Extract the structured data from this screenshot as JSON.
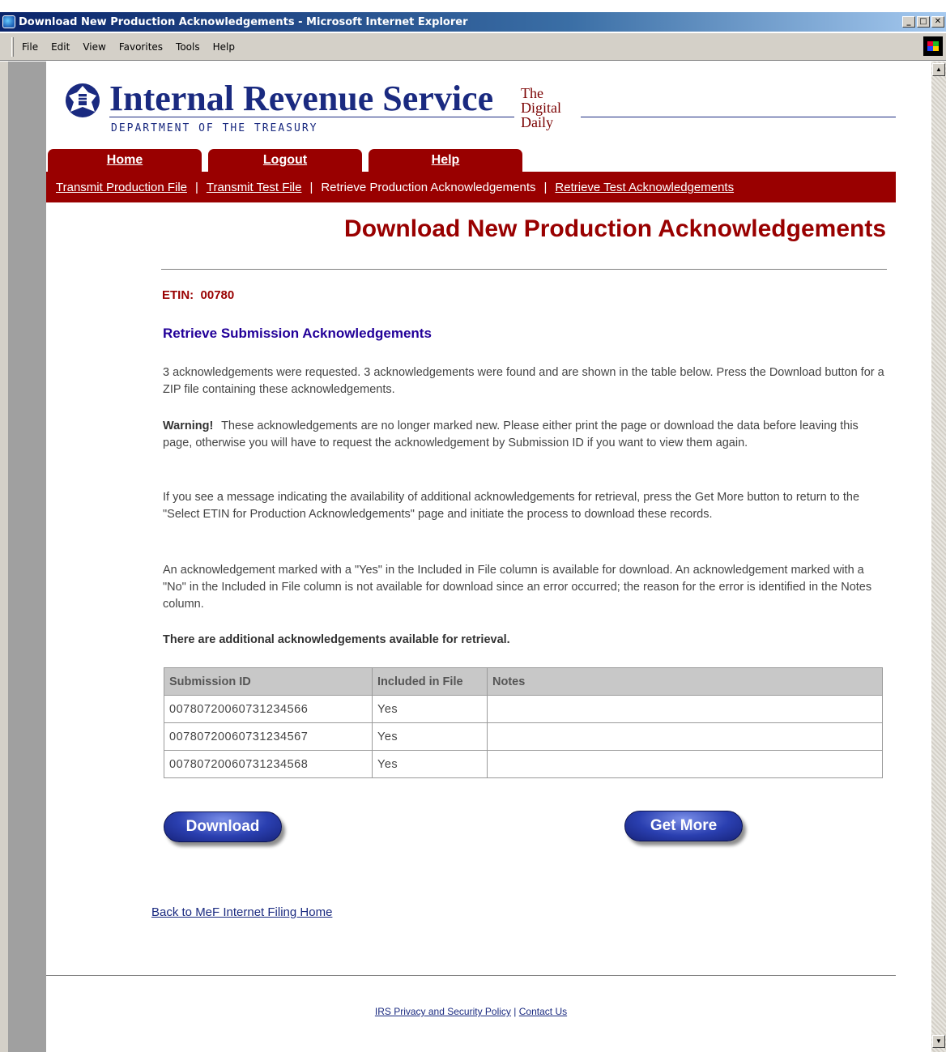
{
  "window": {
    "title": "Download New Production Acknowledgements - Microsoft Internet Explorer",
    "minimize": "_",
    "maximize": "□",
    "close": "✕"
  },
  "menubar": {
    "items": [
      "File",
      "Edit",
      "View",
      "Favorites",
      "Tools",
      "Help"
    ]
  },
  "header": {
    "title": "Internal Revenue Service",
    "dept": "DEPARTMENT OF THE TREASURY",
    "digital_line1": "The",
    "digital_line2": "Digital",
    "digital_line3": "Daily"
  },
  "tabs": [
    "Home",
    "Logout",
    "Help"
  ],
  "subnav": {
    "items": [
      {
        "label": "Transmit Production File",
        "link": true
      },
      {
        "label": "Transmit Test File",
        "link": true
      },
      {
        "label": "Retrieve Production Acknowledgements",
        "link": false
      },
      {
        "label": "Retrieve Test Acknowledgements",
        "link": true
      }
    ],
    "separator": "|"
  },
  "main": {
    "heading": "Download New Production Acknowledgements",
    "etin_label": "ETIN:",
    "etin_value": "00780",
    "section_title": "Retrieve Submission Acknowledgements",
    "para1": "3 acknowledgements were requested. 3 acknowledgements were found and are shown in the table below. Press the Download button for a ZIP file containing these acknowledgements.",
    "warning_label": "Warning!",
    "para2": "These acknowledgements are no longer marked new. Please either print the page or download the data before leaving this page, otherwise you will have to request the acknowledgement by Submission ID if you want to view them again.",
    "para3": "If you see a message indicating the availability of additional acknowledgements for retrieval, press the Get More button to return to the \"Select ETIN for Production Acknowledgements\" page and initiate the process to download these records.",
    "para4": "An acknowledgement marked with a \"Yes\" in the Included in File column is available for download. An acknowledgement marked with a \"No\" in the Included in File column is not available for download since an error occurred; the reason for the error is identified in the Notes column.",
    "additional": "There are additional acknowledgements available for retrieval.",
    "table": {
      "headers": [
        "Submission ID",
        "Included in File",
        "Notes"
      ],
      "rows": [
        [
          "00780720060731234566",
          "Yes",
          ""
        ],
        [
          "00780720060731234567",
          "Yes",
          ""
        ],
        [
          "00780720060731234568",
          "Yes",
          ""
        ]
      ]
    },
    "download_label": "Download",
    "getmore_label": "Get More",
    "back_link": "Back to MeF Internet Filing Home"
  },
  "footer": {
    "privacy": "IRS Privacy and Security Policy",
    "separator": "|",
    "contact": "Contact Us"
  },
  "colors": {
    "brand_red": "#990000",
    "brand_blue": "#1a2a80",
    "section_purple": "#220099"
  }
}
